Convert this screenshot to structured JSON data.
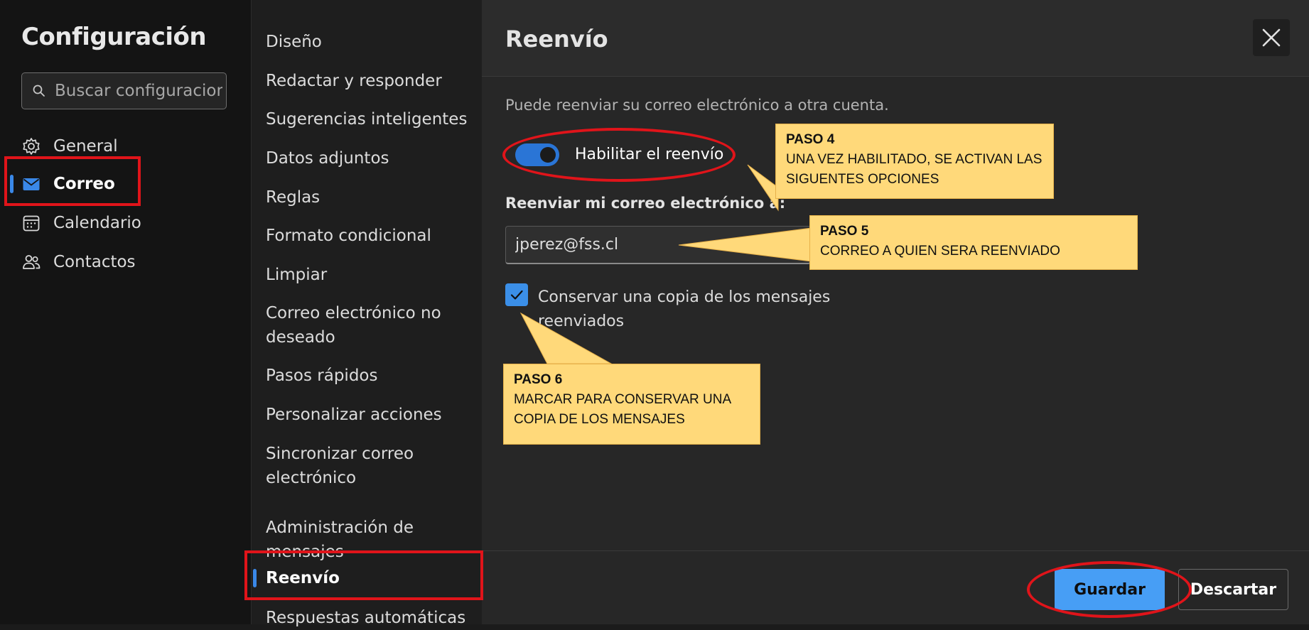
{
  "left_pane": {
    "title": "Configuración",
    "search": {
      "placeholder": "Buscar configuraciones",
      "icon": "search-icon"
    },
    "categories": [
      {
        "label": "General",
        "icon": "gear-icon"
      },
      {
        "label": "Correo",
        "icon": "mail-icon",
        "active": true
      },
      {
        "label": "Calendario",
        "icon": "calendar-icon"
      },
      {
        "label": "Contactos",
        "icon": "people-icon"
      }
    ]
  },
  "middle_pane": {
    "items": [
      {
        "label": "Diseño"
      },
      {
        "label": "Redactar y responder"
      },
      {
        "label": "Sugerencias inteligentes"
      },
      {
        "label": "Datos adjuntos"
      },
      {
        "label": "Reglas"
      },
      {
        "label": "Formato condicional"
      },
      {
        "label": "Limpiar"
      },
      {
        "label": "Correo electrónico no deseado"
      },
      {
        "label": "Pasos rápidos"
      },
      {
        "label": "Personalizar acciones"
      },
      {
        "label": "Sincronizar correo electrónico"
      },
      {
        "label": "Administración de mensajes"
      },
      {
        "label": "Reenvío",
        "active": true
      },
      {
        "label": "Respuestas automáticas"
      }
    ]
  },
  "content": {
    "title": "Reenvío",
    "description": "Puede reenviar su correo electrónico a otra cuenta.",
    "toggle": {
      "label": "Habilitar el reenvío",
      "on": true
    },
    "forward_to": {
      "label": "Reenviar mi correo electrónico a:",
      "value": "jperez@fss.cl"
    },
    "keep_copy": {
      "label": "Conservar una copia de los mensajes reenviados",
      "checked": true
    },
    "save_label": "Guardar",
    "discard_label": "Descartar"
  },
  "annotations": {
    "color": "#e0141a",
    "callout_color": "#ffd97a",
    "callouts": [
      {
        "step": "PASO 4",
        "text": "UNA VEZ HABILITADO, SE ACTIVAN LAS SIGUENTES OPCIONES"
      },
      {
        "step": "PASO 5",
        "text": "CORREO  A QUIEN SERA REENVIADO"
      },
      {
        "step": "PASO 6",
        "text": "MARCAR PARA CONSERVAR UNA COPIA DE LOS MENSAJES"
      }
    ]
  },
  "colors": {
    "accent": "#479ef5",
    "toggle_on": "#2a75d6",
    "background": "#1b1b1b"
  }
}
